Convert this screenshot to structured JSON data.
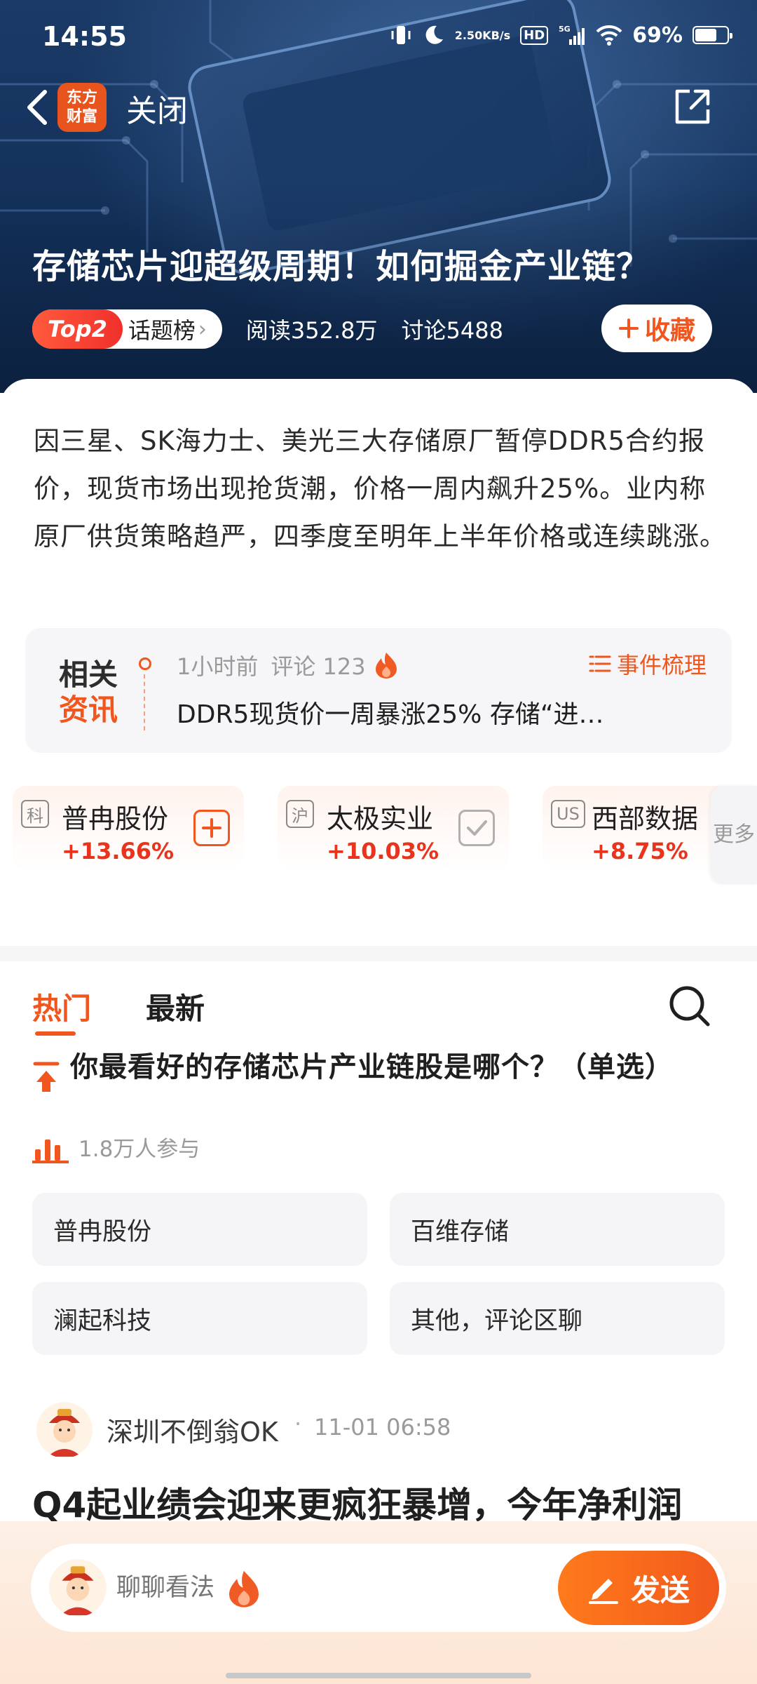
{
  "status_bar": {
    "time": "14:55",
    "net_speed_value": "2.50",
    "net_speed_unit": "KB/s",
    "hd": "HD",
    "network": "5G",
    "battery": "69%",
    "battery_level": 0.69
  },
  "nav": {
    "logo_line1": "东方",
    "logo_line2": "财富",
    "close_label": "关闭"
  },
  "topic": {
    "title": "存储芯片迎超级周期！如何掘金产业链？",
    "rank_badge": "Top2",
    "rank_label": "话题榜",
    "reads": "阅读352.8万",
    "discussions": "讨论5488",
    "favorite_label": "收藏",
    "summary": "因三星、SK海力士、美光三大存储原厂暂停DDR5合约报价，现货市场出现抢货潮，价格一周内飙升25%。业内称原厂供货策略趋严，四季度至明年上半年价格或连续跳涨。"
  },
  "related_news": {
    "logo_line1": "相关",
    "logo_line2": "资讯",
    "time": "1小时前",
    "comment_label": "评论 123",
    "events_label": "事件梳理",
    "headline": "DDR5现货价一周暴涨25% 存储“进…"
  },
  "stocks": [
    {
      "market": "科",
      "name": "普冉股份",
      "change": "+13.66%",
      "action": "add"
    },
    {
      "market": "沪",
      "name": "太极实业",
      "change": "+10.03%",
      "action": "added"
    },
    {
      "market": "US",
      "name": "西部数据",
      "change": "+8.75%",
      "action": "none"
    }
  ],
  "more_label": "更多",
  "tabs": [
    {
      "label": "热门",
      "active": true
    },
    {
      "label": "最新",
      "active": false
    }
  ],
  "poll": {
    "question": "你最看好的存储芯片产业链股是哪个？（单选）",
    "participants": "1.8万人参与",
    "options": [
      "普冉股份",
      "百维存储",
      "澜起科技",
      "其他，评论区聊"
    ]
  },
  "post": {
    "author": "深圳不倒翁OK",
    "separator": "·",
    "time": "11-01 06:58",
    "title": "Q4起业绩会迎来更疯狂暴增，今年净利润"
  },
  "composer": {
    "placeholder": "聊聊看法",
    "send_label": "发送"
  },
  "colors": {
    "accent": "#f0561d",
    "rise": "#e8341c",
    "hero_bg": "#14325c"
  }
}
